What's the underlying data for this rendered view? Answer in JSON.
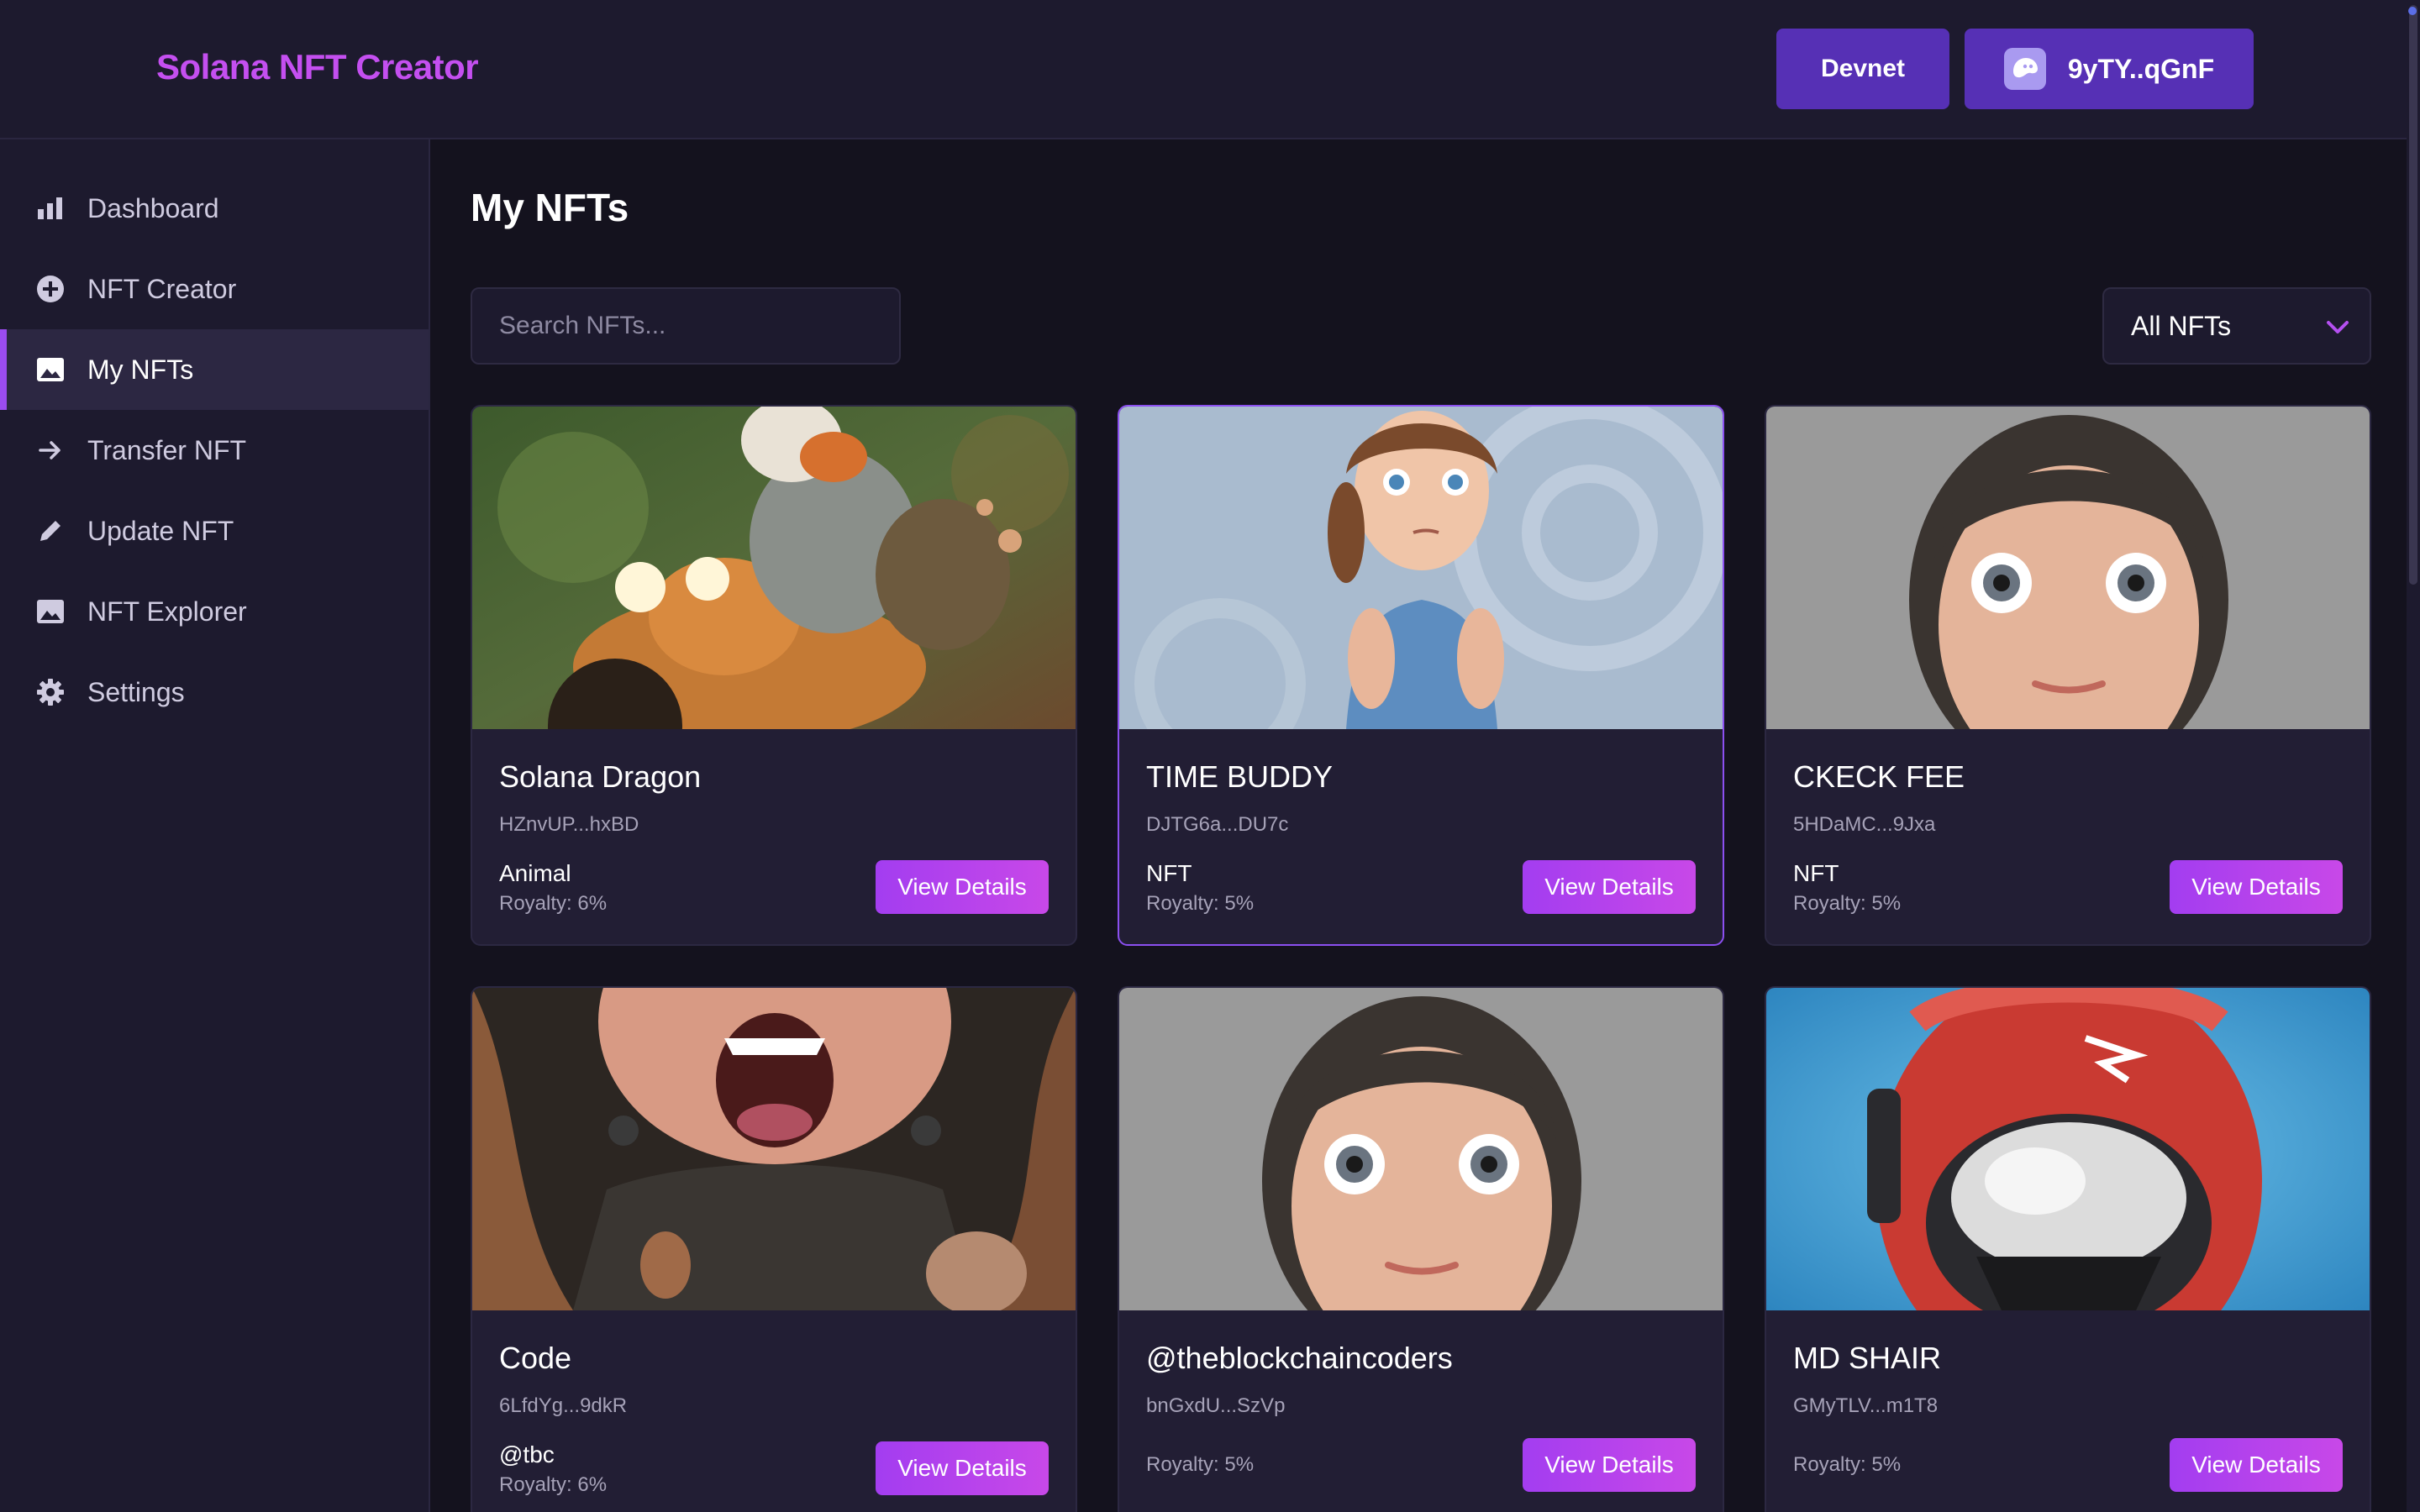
{
  "header": {
    "brand": "Solana NFT Creator",
    "network_label": "Devnet",
    "wallet_label": "9yTY..qGnF"
  },
  "sidebar": {
    "items": [
      {
        "label": "Dashboard",
        "icon": "bar-chart-icon"
      },
      {
        "label": "NFT Creator",
        "icon": "plus-circle-icon"
      },
      {
        "label": "My NFTs",
        "icon": "image-icon",
        "active": true
      },
      {
        "label": "Transfer NFT",
        "icon": "arrow-right-icon"
      },
      {
        "label": "Update NFT",
        "icon": "pencil-icon"
      },
      {
        "label": "NFT Explorer",
        "icon": "image-icon"
      },
      {
        "label": "Settings",
        "icon": "gear-icon"
      }
    ]
  },
  "main": {
    "title": "My NFTs",
    "search": {
      "placeholder": "Search NFTs...",
      "value": ""
    },
    "filter": {
      "selected": "All NFTs"
    },
    "view_details_label": "View Details",
    "nfts": [
      {
        "name": "Solana Dragon",
        "mint": "HZnvUP...hxBD",
        "collection": "Animal",
        "royalty": "Royalty: 6%"
      },
      {
        "name": "TIME BUDDY",
        "mint": "DJTG6a...DU7c",
        "collection": "NFT",
        "royalty": "Royalty: 5%"
      },
      {
        "name": "CKECK FEE",
        "mint": "5HDaMC...9Jxa",
        "collection": "NFT",
        "royalty": "Royalty: 5%"
      },
      {
        "name": "Code",
        "mint": "6LfdYg...9dkR",
        "collection": "@tbc",
        "royalty": "Royalty: 6%"
      },
      {
        "name": "@theblockchaincoders",
        "mint": "bnGxdU...SzVp",
        "collection": "",
        "royalty": "Royalty: 5%"
      },
      {
        "name": "MD SHAIR",
        "mint": "GMyTLV...m1T8",
        "collection": "",
        "royalty": "Royalty: 5%"
      }
    ]
  },
  "colors": {
    "brand": "#c44ff0",
    "accent": "#5630b5",
    "button": "#b043ee",
    "background": "#14121e",
    "panel": "#1d1a2e"
  }
}
